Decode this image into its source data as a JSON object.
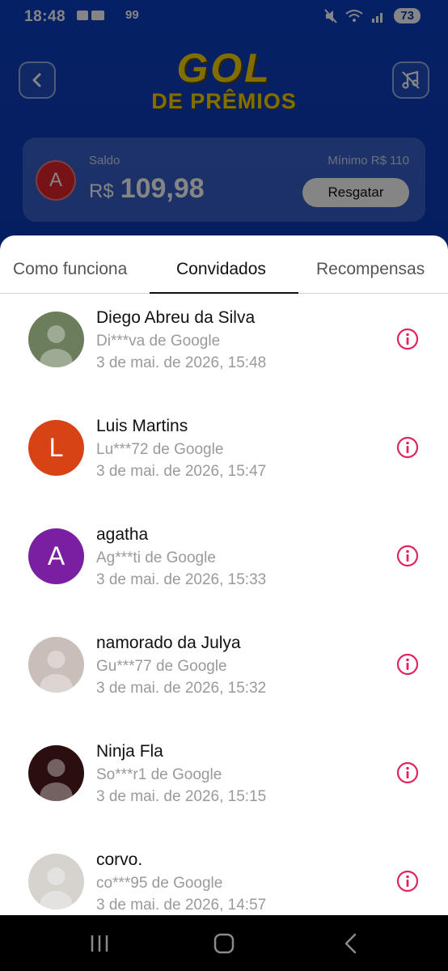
{
  "status_bar": {
    "time": "18:48",
    "left_icons": "99",
    "battery": "73"
  },
  "header": {
    "logo_line1": "GOL",
    "logo_line2": "DE PRÊMIOS"
  },
  "balance": {
    "avatar_letter": "A",
    "label": "Saldo",
    "minimum": "Mínimo  R$ 110",
    "currency": "R$",
    "amount": "109,98",
    "redeem_label": "Resgatar"
  },
  "tabs": [
    {
      "label": "Como funciona",
      "active": false
    },
    {
      "label": "Convidados",
      "active": true
    },
    {
      "label": "Recompensas",
      "active": false
    }
  ],
  "invitees": [
    {
      "name": "Diego Abreu da Silva",
      "account": "Di***va de Google",
      "date": "3 de mai. de 2026, 15:48",
      "avatar_type": "photo",
      "avatar_color": "#6b7d5a",
      "avatar_letter": ""
    },
    {
      "name": "Luis Martins",
      "account": "Lu***72 de Google",
      "date": "3 de mai. de 2026, 15:47",
      "avatar_type": "letter",
      "avatar_color": "#d84315",
      "avatar_letter": "L"
    },
    {
      "name": "agatha",
      "account": "Ag***ti de Google",
      "date": "3 de mai. de 2026, 15:33",
      "avatar_type": "letter",
      "avatar_color": "#7b1fa2",
      "avatar_letter": "A"
    },
    {
      "name": "namorado da Julya",
      "account": "Gu***77 de Google",
      "date": "3 de mai. de 2026, 15:32",
      "avatar_type": "photo",
      "avatar_color": "#c9bfb8",
      "avatar_letter": ""
    },
    {
      "name": "Ninja Fla",
      "account": "So***r1 de Google",
      "date": "3 de mai. de 2026, 15:15",
      "avatar_type": "photo",
      "avatar_color": "#2a0e10",
      "avatar_letter": ""
    },
    {
      "name": "corvo.",
      "account": "co***95 de Google",
      "date": "3 de mai. de 2026, 14:57",
      "avatar_type": "photo",
      "avatar_color": "#d6d3cf",
      "avatar_letter": ""
    }
  ],
  "colors": {
    "info_icon": "#e0245e",
    "logo_yellow": "#f5d400",
    "brand_blue": "#0b3bb8"
  }
}
